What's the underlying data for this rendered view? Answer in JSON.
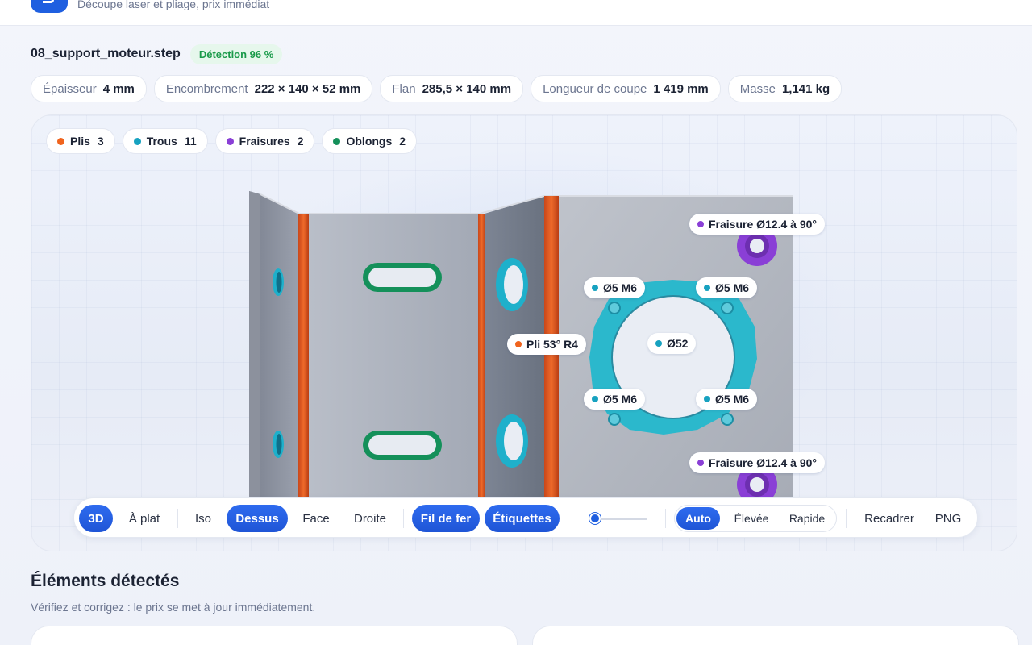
{
  "header": {
    "tagline": "Découpe laser et pliage, prix immédiat"
  },
  "file": {
    "name": "08_support_moteur.step",
    "detection": "Détection 96 %"
  },
  "metrics": [
    {
      "label": "Épaisseur",
      "value": "4 mm"
    },
    {
      "label": "Encombrement",
      "value": "222 × 140 × 52 mm"
    },
    {
      "label": "Flan",
      "value": "285,5 × 140 mm"
    },
    {
      "label": "Longueur de coupe",
      "value": "1 419 mm"
    },
    {
      "label": "Masse",
      "value": "1,141 kg"
    }
  ],
  "legend": [
    {
      "label": "Plis",
      "count": "3",
      "color": "#f0641e"
    },
    {
      "label": "Trous",
      "count": "11",
      "color": "#17a2c0"
    },
    {
      "label": "Fraisures",
      "count": "2",
      "color": "#8a3fd6"
    },
    {
      "label": "Oblongs",
      "count": "2",
      "color": "#14905a"
    }
  ],
  "tags": {
    "fraisure_top": "Fraisure Ø12.4 à 90°",
    "fraisure_bottom": "Fraisure Ø12.4 à 90°",
    "hole_tl": "Ø5 M6",
    "hole_tr": "Ø5 M6",
    "hole_bl": "Ø5 M6",
    "hole_br": "Ø5 M6",
    "bore": "Ø52",
    "bend": "Pli 53° R4"
  },
  "toolbar": {
    "mode_3d": "3D",
    "mode_flat": "À plat",
    "view_iso": "Iso",
    "view_top": "Dessus",
    "view_front": "Face",
    "view_right": "Droite",
    "wireframe": "Fil de fer",
    "labels": "Étiquettes",
    "quality_auto": "Auto",
    "quality_high": "Élevée",
    "quality_fast": "Rapide",
    "reframe": "Recadrer",
    "png": "PNG"
  },
  "slider_value": 0.05,
  "colors": {
    "accent": "#1f5fe0",
    "bend": "#f0641e",
    "hole": "#17a2c0",
    "countersink": "#8a3fd6",
    "slot": "#14905a"
  },
  "detected": {
    "title": "Éléments détectés",
    "subtitle": "Vérifiez et corrigez : le prix se met à jour immédiatement."
  }
}
